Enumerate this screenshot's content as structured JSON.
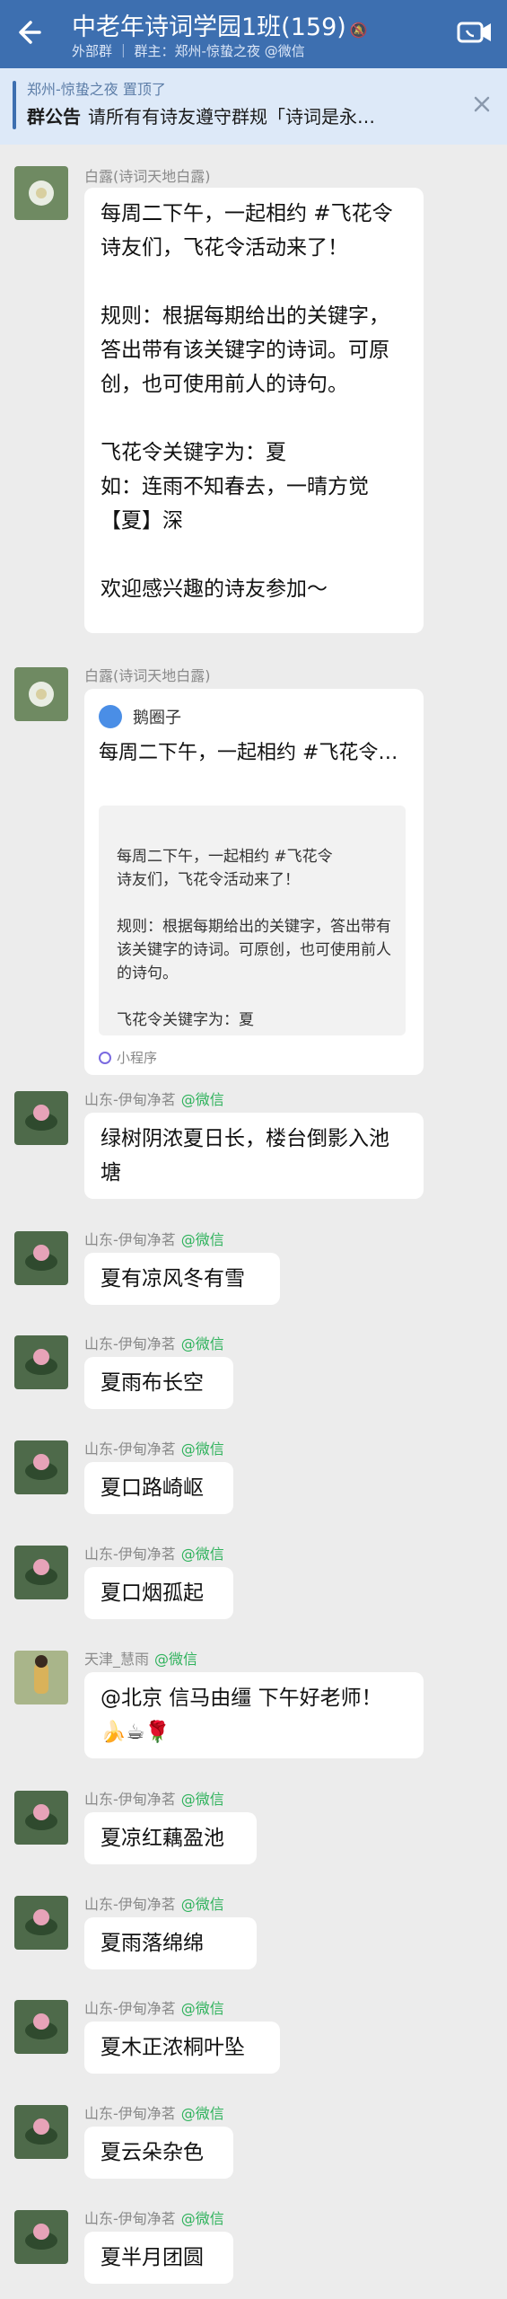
{
  "header": {
    "title": "中老年诗词学园1班(159)",
    "subtitle": "外部群 ｜ 群主：郑州-惊蛰之夜 @微信",
    "colors": {
      "bar": "#3d6fb0",
      "text": "#ffffff"
    }
  },
  "notice": {
    "pinned_text": "郑州-惊蛰之夜 置顶了",
    "label": "群公告",
    "text": "请所有有诗友遵守群规「诗词是永…"
  },
  "messages": [
    {
      "sender": "白露(诗词天地白露)",
      "wechat": "",
      "text": "每周二下午，一起相约 #飞花令\n诗友们，飞花令活动来了！\n\n规则：根据每期给出的关键字，答出带有该关键字的诗词。可原创，也可使用前人的诗句。\n\n飞花令关键字为：夏\n如：连雨不知春去，一晴方觉【夏】深\n\n欢迎感兴趣的诗友参加～"
    },
    {
      "sender": "白露(诗词天地白露)",
      "wechat": "",
      "card": {
        "app": "鹅圈子",
        "text": "每周二下午，一起相约 #飞花令…",
        "preview": "每周二下午，一起相约 #飞花令\n诗友们，飞花令活动来了！\n\n规则：根据每期给出的关键字，答出带有该关键字的诗词。可原创，也可使用前人的诗句。\n\n飞花令关键字为：夏",
        "footer": "小程序"
      }
    },
    {
      "sender": "山东-伊甸净茗",
      "wechat": "@微信",
      "text": "绿树阴浓夏日长，楼台倒影入池塘"
    },
    {
      "sender": "山东-伊甸净茗",
      "wechat": "@微信",
      "text": "夏有凉风冬有雪"
    },
    {
      "sender": "山东-伊甸净茗",
      "wechat": "@微信",
      "text": "夏雨布长空"
    },
    {
      "sender": "山东-伊甸净茗",
      "wechat": "@微信",
      "text": "夏口路崎岖"
    },
    {
      "sender": "山东-伊甸净茗",
      "wechat": "@微信",
      "text": "夏口烟孤起"
    },
    {
      "sender": "天津_慧雨",
      "wechat": "@微信",
      "text": "@北京 信马由缰 下午好老师！\n🍌☕🌹"
    },
    {
      "sender": "山东-伊甸净茗",
      "wechat": "@微信",
      "text": "夏凉红藕盈池"
    },
    {
      "sender": "山东-伊甸净茗",
      "wechat": "@微信",
      "text": "夏雨落绵绵"
    },
    {
      "sender": "山东-伊甸净茗",
      "wechat": "@微信",
      "text": "夏木正浓桐叶坠"
    },
    {
      "sender": "山东-伊甸净茗",
      "wechat": "@微信",
      "text": "夏云朵杂色"
    },
    {
      "sender": "山东-伊甸净茗",
      "wechat": "@微信",
      "text": "夏半月团圆"
    }
  ]
}
